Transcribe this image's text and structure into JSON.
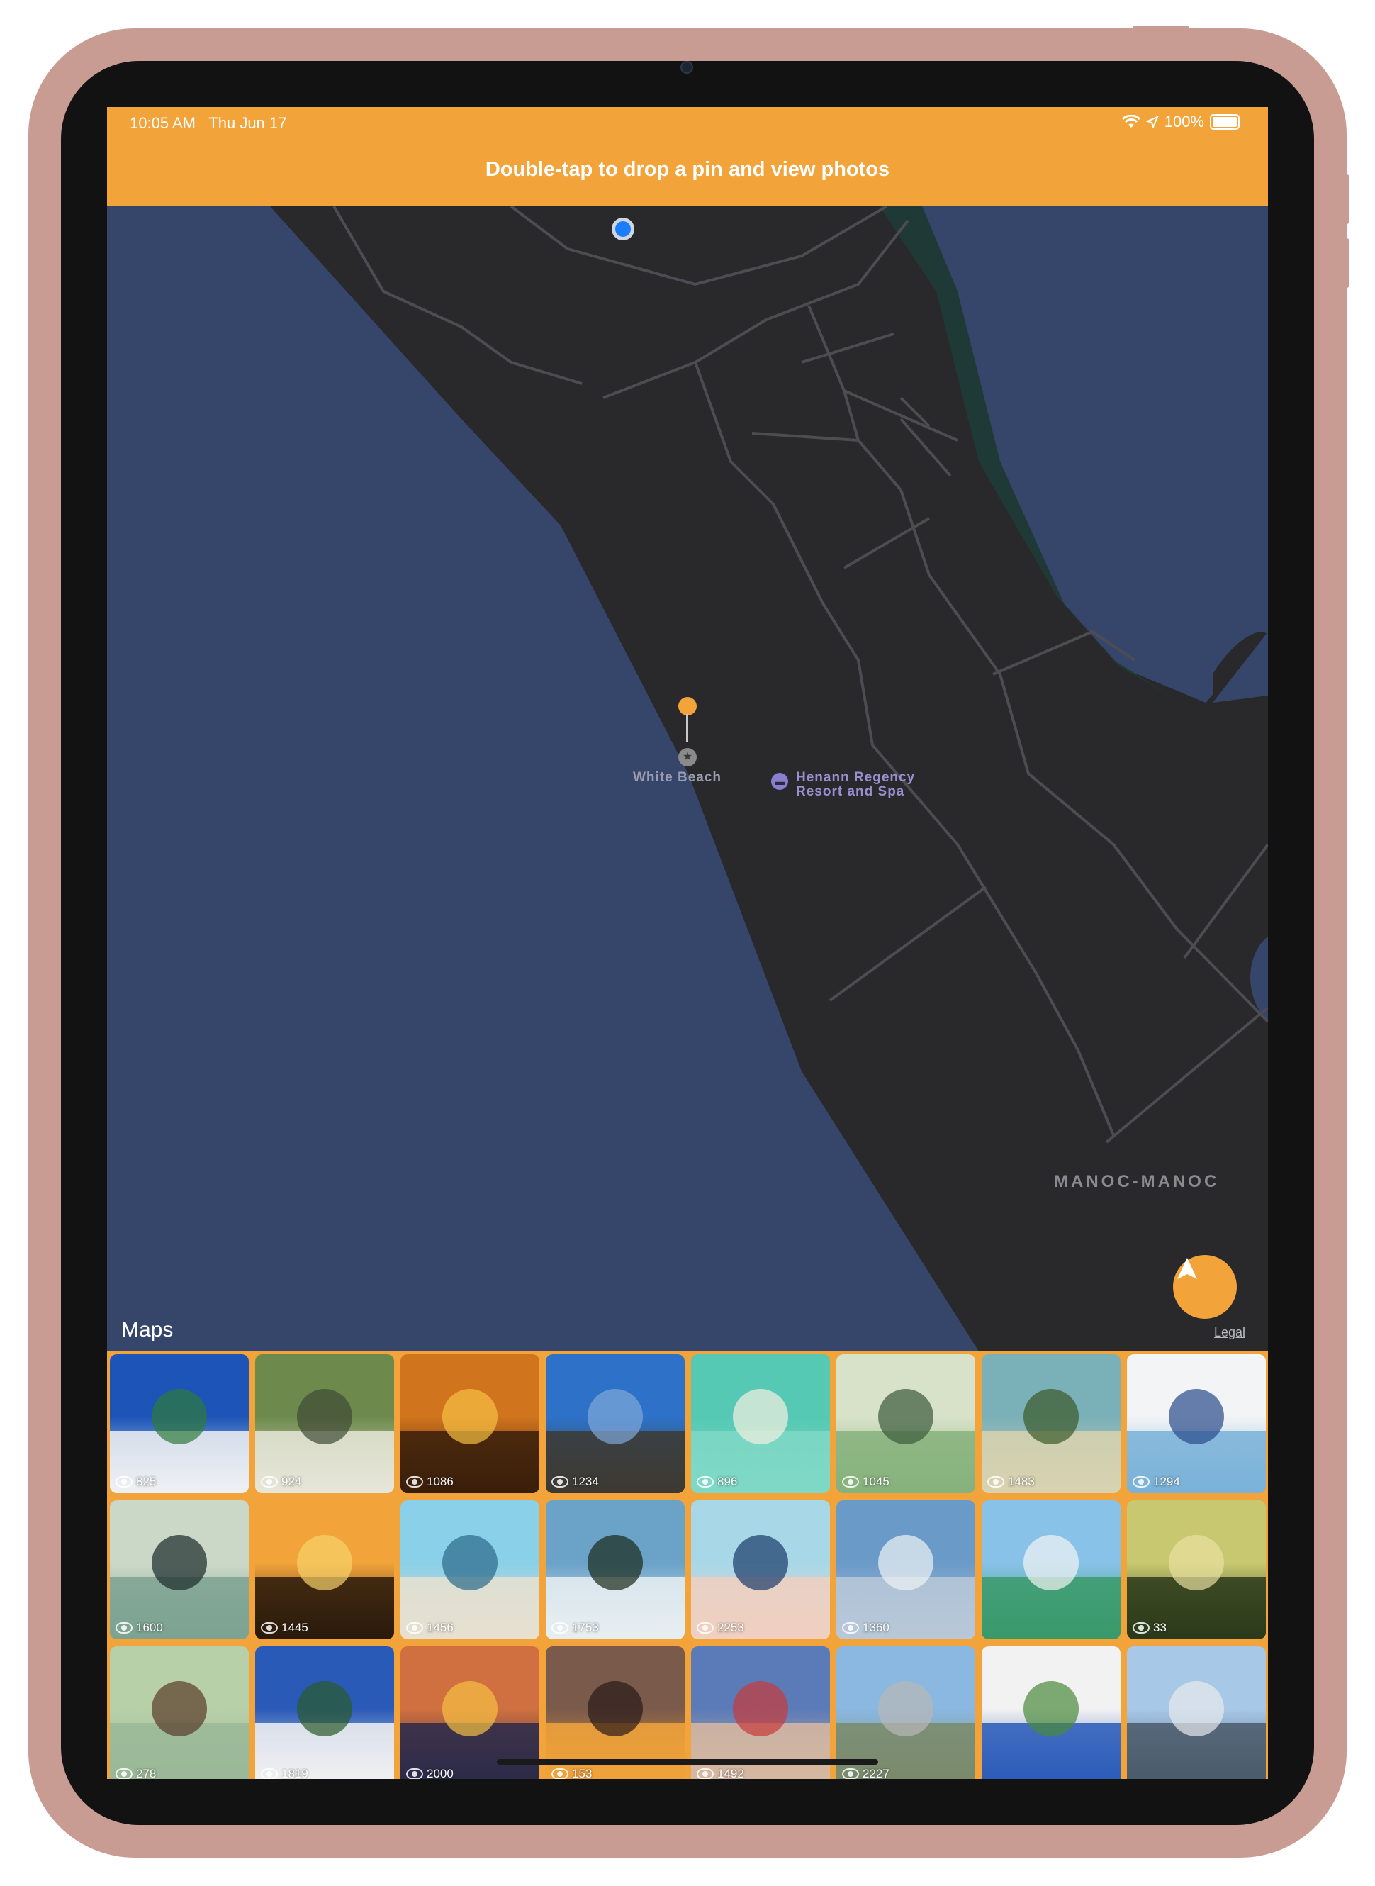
{
  "status_bar": {
    "time": "10:05 AM",
    "date": "Thu Jun 17",
    "battery": "100%"
  },
  "banner": {
    "text": "Double-tap to drop a pin and view photos"
  },
  "map": {
    "poi_label": "White Beach",
    "hotel_line1": "Henann Regency",
    "hotel_line2": "Resort and Spa",
    "district_label": "MANOC-MANOC",
    "maps_logo": "Maps",
    "legal_link": "Legal"
  },
  "photos": [
    {
      "views": "825",
      "c1": "#1c54b7",
      "c2": "#eef1f3",
      "c3": "#2f7a3a"
    },
    {
      "views": "924",
      "c1": "#6d8a4c",
      "c2": "#e6e6d8",
      "c3": "#3e4a35"
    },
    {
      "views": "1086",
      "c1": "#d0741e",
      "c2": "#3a1e0c",
      "c3": "#f7c043"
    },
    {
      "views": "1234",
      "c1": "#2d72c8",
      "c2": "#3d3a32",
      "c3": "#7fa8d8"
    },
    {
      "views": "896",
      "c1": "#55c9b4",
      "c2": "#7fd8c6",
      "c3": "#f5f0e0"
    },
    {
      "views": "1045",
      "c1": "#d8e2c8",
      "c2": "#86b27c",
      "c3": "#3a5a3a"
    },
    {
      "views": "1483",
      "c1": "#7ab0b8",
      "c2": "#d8d2b0",
      "c3": "#3a5a2a"
    },
    {
      "views": "1294",
      "c1": "#f2f4f6",
      "c2": "#7ab2d8",
      "c3": "#2a4a8a"
    },
    {
      "views": "1600",
      "c1": "#cbd8c8",
      "c2": "#7ca292",
      "c3": "#1a2a2a"
    },
    {
      "views": "1445",
      "c1": "#f2a33a",
      "c2": "#2a1a0c",
      "c3": "#f7d26a"
    },
    {
      "views": "1456",
      "c1": "#8ad0e8",
      "c2": "#e8e0d0",
      "c3": "#2a6a8a"
    },
    {
      "views": "1753",
      "c1": "#6aa2c8",
      "c2": "#e8eef2",
      "c3": "#1a2a1a"
    },
    {
      "views": "2253",
      "c1": "#a8d8e8",
      "c2": "#f0d0c0",
      "c3": "#1a3a6a"
    },
    {
      "views": "1360",
      "c1": "#6a9ac8",
      "c2": "#b8c8d8",
      "c3": "#f0f2f4"
    },
    {
      "views": "",
      "c1": "#88c2e8",
      "c2": "#3a9a6a",
      "c3": "#f4f4f4"
    },
    {
      "views": "33",
      "c1": "#c8c870",
      "c2": "#2a3a1a",
      "c3": "#e8e0a0"
    },
    {
      "views": "278",
      "c1": "#b8d0a8",
      "c2": "#9ab898",
      "c3": "#5a3a2a"
    },
    {
      "views": "1819",
      "c1": "#2a5ab8",
      "c2": "#f2f2f2",
      "c3": "#2a5a2a"
    },
    {
      "views": "2000",
      "c1": "#d07040",
      "c2": "#2a2a4a",
      "c3": "#f7c043"
    },
    {
      "views": "153",
      "c1": "#7a5a4a",
      "c2": "#f2a33a",
      "c3": "#2a1a1a"
    },
    {
      "views": "1492",
      "c1": "#5a7ab8",
      "c2": "#d8b8a0",
      "c3": "#c83a3a"
    },
    {
      "views": "2227",
      "c1": "#8ab8e0",
      "c2": "#7a8a6a",
      "c3": "#b8b8b8"
    },
    {
      "views": "",
      "c1": "#f2f2f2",
      "c2": "#2a5ab8",
      "c3": "#4a8a3a"
    },
    {
      "views": "",
      "c1": "#a8c8e8",
      "c2": "#4a5a6a",
      "c3": "#e8eaec"
    }
  ]
}
